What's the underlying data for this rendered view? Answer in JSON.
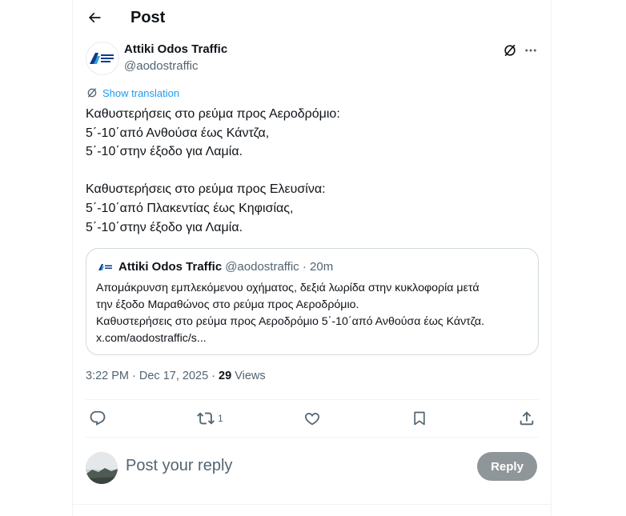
{
  "header": {
    "title": "Post"
  },
  "author": {
    "name": "Attiki Odos Traffic",
    "handle": "@aodostraffic",
    "avatar_text": "ΑΤΤΙΚΗ ΟΔΟΣ"
  },
  "translation": {
    "label": "Show translation"
  },
  "tweet": {
    "lines": [
      "Καθυστερήσεις στο ρεύμα προς Αεροδρόμιο:",
      "5΄-10΄από Ανθούσα έως Κάντζα,",
      "5΄-10΄στην έξοδο για Λαμία.",
      "",
      "Καθυστερήσεις στο ρεύμα προς Ελευσίνα:",
      "5΄-10΄από Πλακεντίας έως Κηφισίας,",
      "5΄-10΄στην έξοδο για Λαμία."
    ]
  },
  "quote": {
    "name": "Attiki Odos Traffic",
    "meta": "@aodostraffic · 20m",
    "lines": [
      "Απομάκρυνση εμπλεκόμενου οχήματος, δεξιά λωρίδα στην κυκλοφορία μετά",
      "την έξοδο Μαραθώνος στο ρεύμα προς Αεροδρόμιο.",
      "Καθυστερήσεις στο ρεύμα προς Αεροδρόμιο 5΄-10΄από Ανθούσα έως Κάντζα.",
      "x.com/aodostraffic/s..."
    ]
  },
  "meta": {
    "timestamp": "3:22 PM · Dec 17, 2025 · ",
    "views_count": "29",
    "views_label": " Views"
  },
  "actions": {
    "retweet_count": "1"
  },
  "reply": {
    "placeholder": "Post your reply",
    "button_label": "Reply"
  },
  "colors": {
    "accent": "#1d9bf0",
    "text": "#0f1419",
    "muted": "#536471",
    "reply_button": "#8f9699"
  }
}
